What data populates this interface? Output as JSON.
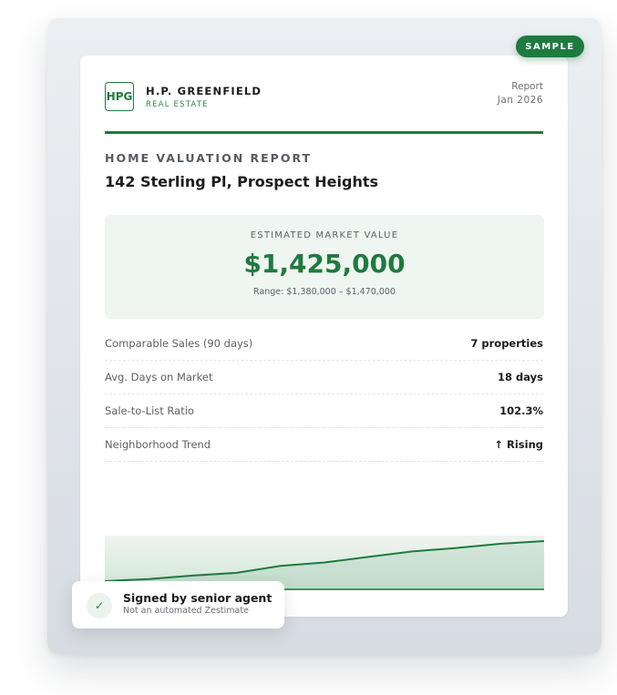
{
  "badge": {
    "label": "SAMPLE"
  },
  "brand": {
    "logo_text": "HPG",
    "name": "H.P. GREENFIELD",
    "subtitle": "REAL ESTATE",
    "accent_color": "#1f7a40"
  },
  "report": {
    "label": "Report",
    "date": "Jan 2026",
    "title": "HOME VALUATION REPORT",
    "address": "142 Sterling Pl, Prospect Heights"
  },
  "valuation": {
    "label": "ESTIMATED MARKET VALUE",
    "amount": "$1,425,000",
    "range": "Range: $1,380,000 – $1,470,000"
  },
  "stats": [
    {
      "label": "Comparable Sales (90 days)",
      "value": "7 properties"
    },
    {
      "label": "Avg. Days on Market",
      "value": "18 days"
    },
    {
      "label": "Sale-to-List Ratio",
      "value": "102.3%"
    },
    {
      "label": "Neighborhood Trend",
      "value": "↑ Rising"
    }
  ],
  "trend": {
    "values": [
      0,
      3,
      8,
      12,
      22,
      27,
      35,
      43,
      48,
      54,
      58
    ],
    "line_color": "#1f7a40"
  },
  "signed": {
    "icon": "check-icon",
    "title": "Signed by senior agent",
    "subtitle": "Not an automated Zestimate"
  }
}
